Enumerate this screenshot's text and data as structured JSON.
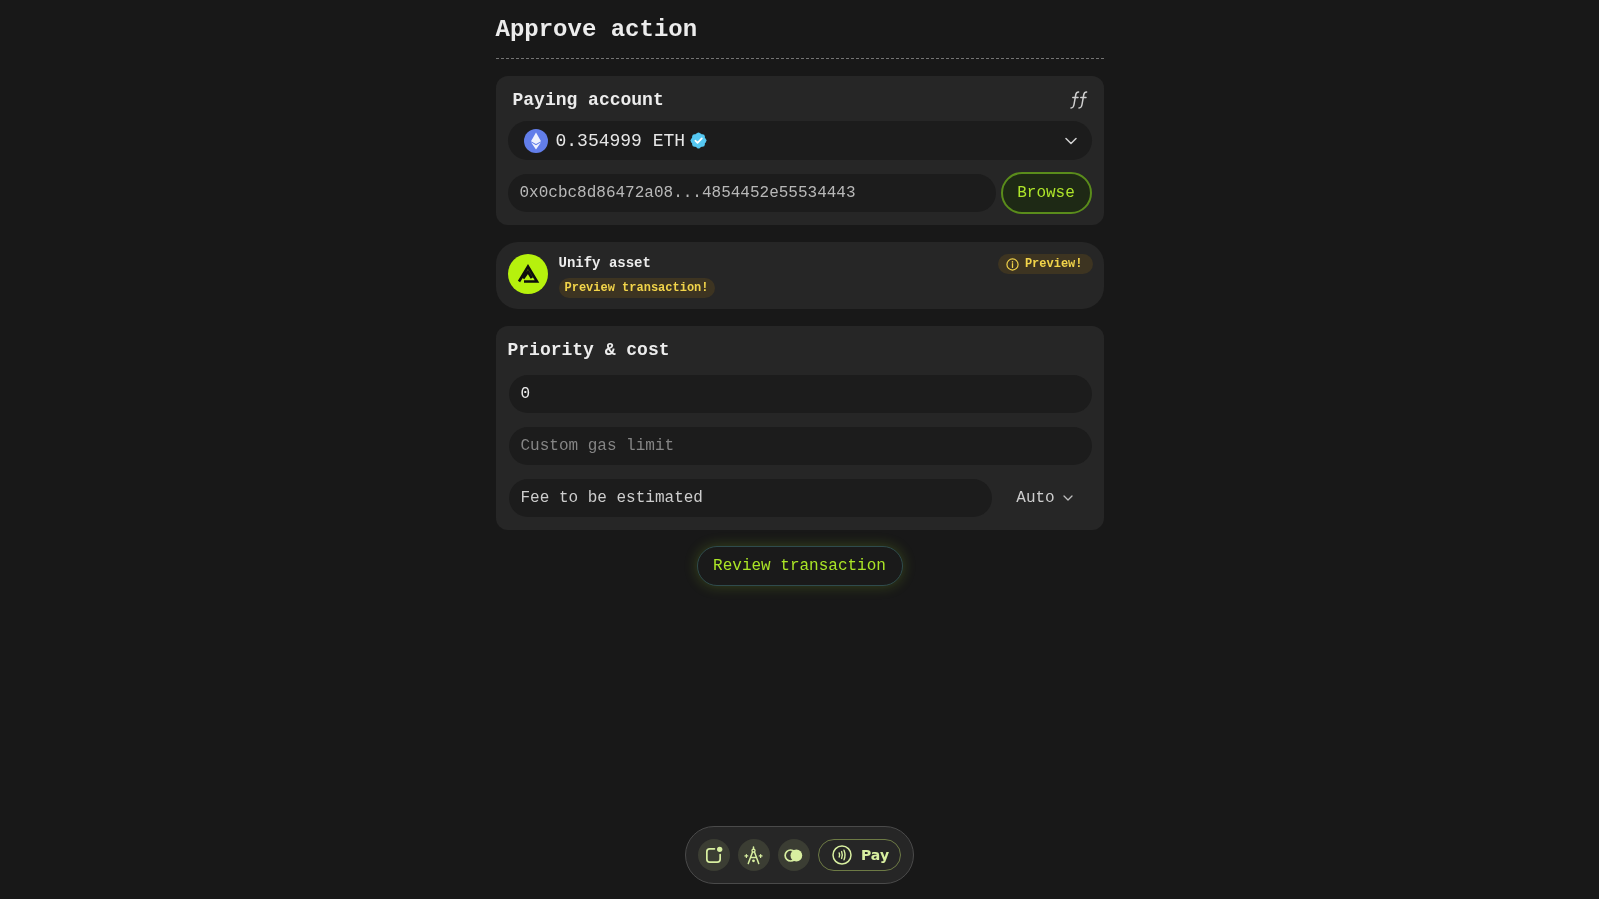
{
  "header": {
    "title": "Approve action"
  },
  "paying_account": {
    "title": "Paying account",
    "balance": "0.354999 ETH",
    "verified": true,
    "address": "0x0cbc8d86472a08...4854452e55534443",
    "browse_button": "Browse"
  },
  "action": {
    "title": "Unify asset",
    "tag": "Preview transaction!",
    "badge": "Preview!"
  },
  "priority_cost": {
    "title": "Priority & cost",
    "fields": [
      {
        "value": "0"
      },
      {
        "placeholder": "Custom gas limit"
      }
    ],
    "fee": {
      "value": "Fee to be estimated",
      "speed": "Auto"
    }
  },
  "review_button": "Review transaction",
  "dock": {
    "pay_label": "Pay"
  }
}
